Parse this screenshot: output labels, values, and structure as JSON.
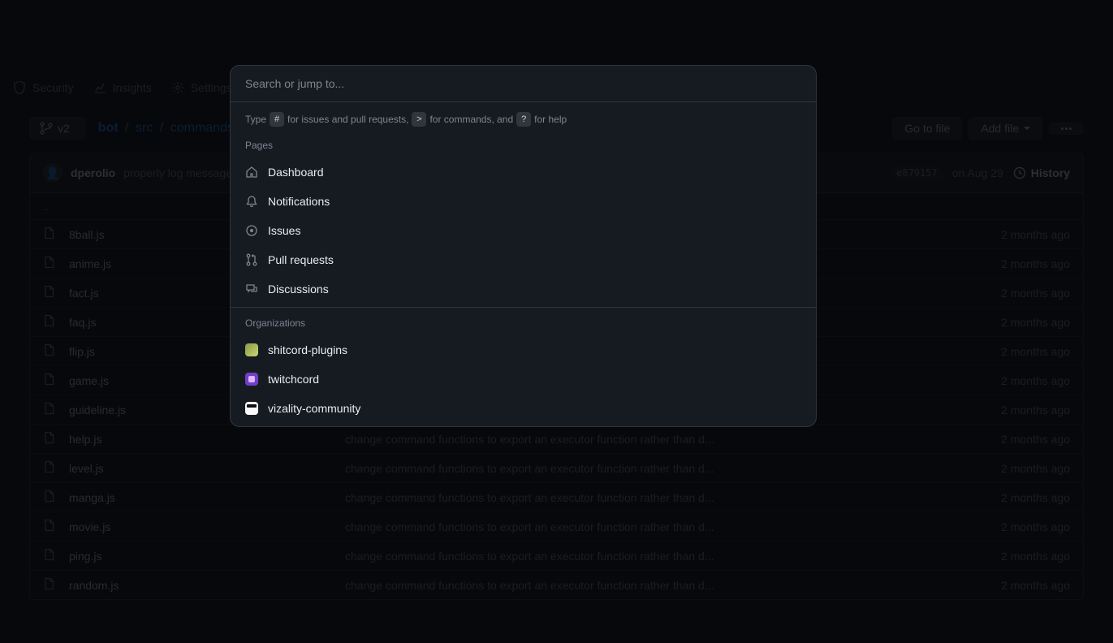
{
  "nav": {
    "security": "Security",
    "insights": "Insights",
    "settings": "Settings"
  },
  "branch": "v2",
  "breadcrumb": {
    "root": "bot",
    "mid": "src",
    "leaf": "commands"
  },
  "actions": {
    "go_to_file": "Go to file",
    "add_file": "Add file"
  },
  "commit": {
    "author": "dperolio",
    "message": "properly log messages",
    "sha": "e879157",
    "date": "on Aug 29",
    "history": "History"
  },
  "updir": "..",
  "long_msg": "change command functions to export an executor function rather than d...",
  "files": [
    {
      "name": "8ball.js",
      "time": "2 months ago"
    },
    {
      "name": "anime.js",
      "time": "2 months ago"
    },
    {
      "name": "fact.js",
      "time": "2 months ago"
    },
    {
      "name": "faq.js",
      "time": "2 months ago"
    },
    {
      "name": "flip.js",
      "time": "2 months ago"
    },
    {
      "name": "game.js",
      "time": "2 months ago"
    },
    {
      "name": "guideline.js",
      "time": "2 months ago"
    },
    {
      "name": "help.js",
      "time": "2 months ago"
    },
    {
      "name": "level.js",
      "time": "2 months ago"
    },
    {
      "name": "manga.js",
      "time": "2 months ago"
    },
    {
      "name": "movie.js",
      "time": "2 months ago"
    },
    {
      "name": "ping.js",
      "time": "2 months ago"
    },
    {
      "name": "random.js",
      "time": "2 months ago"
    }
  ],
  "modal": {
    "placeholder": "Search or jump to...",
    "hint_type": "Type",
    "hint_hash": "#",
    "hint_issues": "for issues and pull requests,",
    "hint_gt": ">",
    "hint_commands": "for commands, and",
    "hint_q": "?",
    "hint_help": "for help",
    "pages_label": "Pages",
    "pages": {
      "dashboard": "Dashboard",
      "notifications": "Notifications",
      "issues": "Issues",
      "pull_requests": "Pull requests",
      "discussions": "Discussions"
    },
    "orgs_label": "Organizations",
    "orgs": {
      "shitcord": "shitcord-plugins",
      "twitchcord": "twitchcord",
      "vizality": "vizality-community"
    }
  }
}
